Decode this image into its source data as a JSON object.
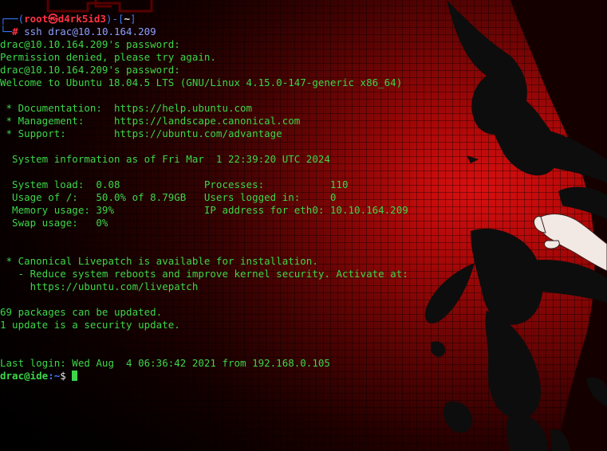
{
  "prompt_header": {
    "open": "┌──(",
    "user_host": "root㉿d4rk5id3",
    "mid": ")-[",
    "cwd": "~",
    "close": "]"
  },
  "prompt_cmd": {
    "corner": "└─",
    "symbol": "#",
    "command": "ssh drac@10.10.164.209"
  },
  "output_lines": [
    "drac@10.10.164.209's password:",
    "Permission denied, please try again.",
    "drac@10.10.164.209's password:",
    "Welcome to Ubuntu 18.04.5 LTS (GNU/Linux 4.15.0-147-generic x86_64)",
    "",
    " * Documentation:  https://help.ubuntu.com",
    " * Management:     https://landscape.canonical.com",
    " * Support:        https://ubuntu.com/advantage",
    "",
    "  System information as of Fri Mar  1 22:39:20 UTC 2024",
    "",
    "  System load:  0.08              Processes:           110",
    "  Usage of /:   50.0% of 8.79GB   Users logged in:     0",
    "  Memory usage: 39%               IP address for eth0: 10.10.164.209",
    "  Swap usage:   0%",
    "",
    "",
    " * Canonical Livepatch is available for installation.",
    "   - Reduce system reboots and improve kernel security. Activate at:",
    "     https://ubuntu.com/livepatch",
    "",
    "69 packages can be updated.",
    "1 update is a security update.",
    "",
    "",
    "Last login: Wed Aug  4 06:36:42 2021 from 192.168.0.105"
  ],
  "remote_prompt": {
    "user_host": "drac@ide",
    "path": ":~",
    "symbol": "$ "
  },
  "colors": {
    "text": "#3dd64a",
    "prompt_blue": "#3a7bff",
    "prompt_red": "#ff3344",
    "background_red": "#b30808"
  }
}
